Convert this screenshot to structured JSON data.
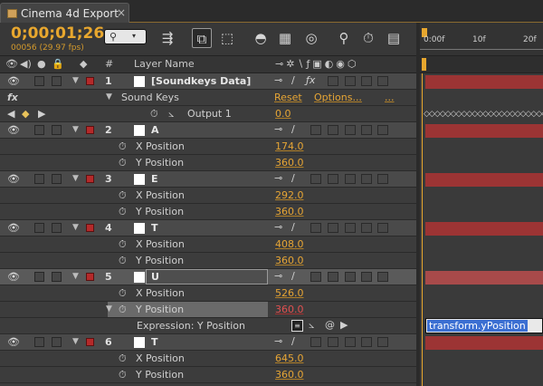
{
  "tab": {
    "title": "Cinema 4d Export",
    "close": "×"
  },
  "time": {
    "timecode": "0;00;01;26",
    "frames": "00056 (29.97 fps)"
  },
  "search": {
    "icon": "search-icon",
    "arrow": "▾"
  },
  "columns": {
    "index": "#",
    "layer_name": "Layer Name"
  },
  "ruler": {
    "t0": "0:00f",
    "t1": "10f",
    "t2": "20f"
  },
  "layers": [
    {
      "num": "1",
      "name": "[Soundkeys Data]"
    },
    {
      "num": "2",
      "name": "A"
    },
    {
      "num": "3",
      "name": "E"
    },
    {
      "num": "4",
      "name": "T"
    },
    {
      "num": "5",
      "name": "U"
    },
    {
      "num": "6",
      "name": "T"
    }
  ],
  "soundkeys": {
    "fx_label": "fx",
    "effect": "Sound Keys",
    "reset": "Reset",
    "options": "Options...",
    "more": "...",
    "output": "Output 1",
    "output_value": "0.0"
  },
  "props": {
    "x": "X Position",
    "y": "Y Position",
    "values": {
      "a_x": "174.0",
      "a_y": "360.0",
      "e_x": "292.0",
      "e_y": "360.0",
      "t_x": "408.0",
      "t_y": "360.0",
      "u_x": "526.0",
      "u_y": "360.0",
      "t2_x": "645.0",
      "t2_y": "360.0"
    }
  },
  "expression": {
    "label": "Expression: Y Position",
    "code": "transform.yPosition"
  },
  "colors": {
    "accent": "#e8a72e",
    "label_red": "#b42a2a",
    "bar": "#9c3434"
  }
}
